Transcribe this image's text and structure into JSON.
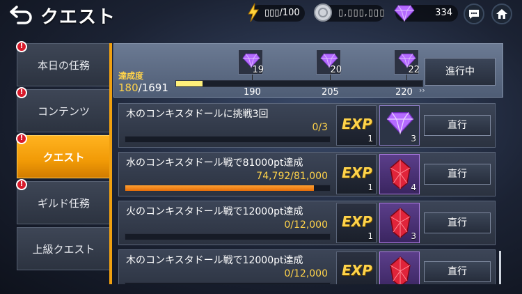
{
  "header": {
    "title": "クエスト",
    "stamina": "▯▯▯/100",
    "coins": "▯,▯▯▯,▯▯▯",
    "gems": "334"
  },
  "sidebar": {
    "items": [
      {
        "label": "本日の任務",
        "badge": "!"
      },
      {
        "label": "コンテンツ",
        "badge": "!"
      },
      {
        "label": "クエスト",
        "badge": "!"
      },
      {
        "label": "ギルド任務",
        "badge": "!"
      },
      {
        "label": "上級クエスト",
        "badge": ""
      }
    ]
  },
  "progress": {
    "label": "達成度",
    "current": "180",
    "total": "/1691",
    "fraction": 0.106,
    "milestones": [
      {
        "reward_count": "19",
        "threshold": "190"
      },
      {
        "reward_count": "20",
        "threshold": "205"
      },
      {
        "reward_count": "22",
        "threshold": "220"
      }
    ],
    "more": "››",
    "status_label": "進行中"
  },
  "quests": [
    {
      "title": "木のコンキスタドールに挑戦3回",
      "value": "0/3",
      "fraction": 0,
      "exp_label": "EXP",
      "exp_count": "1",
      "reward_count": "3",
      "reward_type": "gem",
      "go_label": "直行"
    },
    {
      "title": "水のコンキスタドール戦で81000pt達成",
      "value": "74,792/81,000",
      "fraction": 0.923,
      "exp_label": "EXP",
      "exp_count": "1",
      "reward_count": "4",
      "reward_type": "crystal",
      "go_label": "直行"
    },
    {
      "title": "火のコンキスタドール戦で12000pt達成",
      "value": "0/12,000",
      "fraction": 0,
      "exp_label": "EXP",
      "exp_count": "1",
      "reward_count": "3",
      "reward_type": "crystal",
      "go_label": "直行"
    },
    {
      "title": "木のコンキスタドール戦で12000pt達成",
      "value": "0/12,000",
      "fraction": 0,
      "exp_label": "EXP",
      "exp_count": "",
      "reward_count": "",
      "reward_type": "crystal",
      "go_label": "直行"
    }
  ],
  "colors": {
    "accent": "#f19a06",
    "progress_fill": "#fff07a",
    "quest_fill": "#e56d0a",
    "value_text": "#ffd34a"
  }
}
